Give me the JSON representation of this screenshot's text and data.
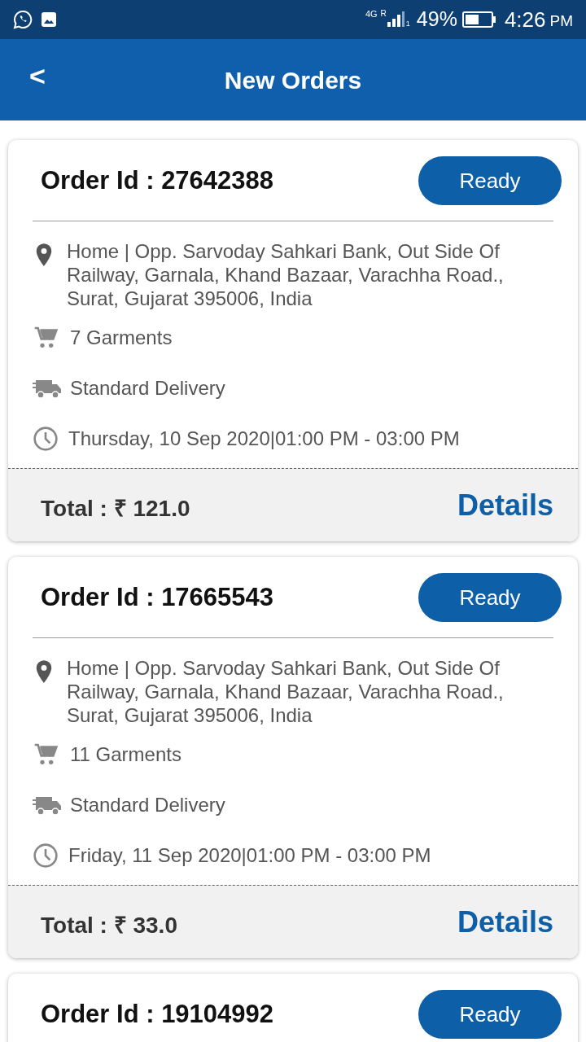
{
  "status_bar": {
    "network": "4G",
    "roaming": "R",
    "sim": "1",
    "battery": "49%",
    "time": "4:26",
    "ampm": "PM"
  },
  "app_bar": {
    "back": "<",
    "title": "New Orders"
  },
  "orders": [
    {
      "order_id": "Order Id : 27642388",
      "status": "Ready",
      "address": "Home | Opp. Sarvoday Sahkari Bank, Out Side Of Railway, Garnala, Khand Bazaar, Varachha Road., Surat, Gujarat 395006, India",
      "garments": "7 Garments",
      "delivery": "Standard Delivery",
      "slot": "Thursday, 10 Sep 2020|01:00 PM - 03:00 PM",
      "total": "Total : ₹ 121.0",
      "details": "Details"
    },
    {
      "order_id": "Order Id : 17665543",
      "status": "Ready",
      "address": "Home | Opp. Sarvoday Sahkari Bank, Out Side Of Railway, Garnala, Khand Bazaar, Varachha Road., Surat, Gujarat 395006, India",
      "garments": "11 Garments",
      "delivery": "Standard Delivery",
      "slot": "Friday, 11 Sep 2020|01:00 PM - 03:00 PM",
      "total": "Total : ₹ 33.0",
      "details": "Details"
    },
    {
      "order_id": "Order Id : 19104992",
      "status": "Ready"
    }
  ]
}
